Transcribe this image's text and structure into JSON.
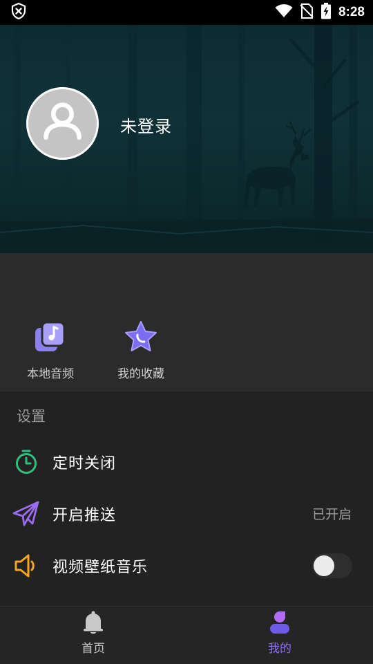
{
  "status_bar": {
    "time": "8:28",
    "icons": [
      "shield-x-icon",
      "wifi-icon",
      "no-sim-icon",
      "battery-charging-icon"
    ]
  },
  "profile": {
    "avatar_icon": "default-avatar-icon",
    "login_text": "未登录"
  },
  "quick_actions": [
    {
      "label": "本地音频",
      "icon": "local-audio-icon"
    },
    {
      "label": "我的收藏",
      "icon": "favorites-star-icon"
    }
  ],
  "settings": {
    "title": "设置",
    "items": [
      {
        "label": "定时关闭",
        "icon": "timer-icon",
        "value": ""
      },
      {
        "label": "开启推送",
        "icon": "paper-plane-icon",
        "value": "已开启"
      },
      {
        "label": "视频壁纸音乐",
        "icon": "speaker-icon",
        "toggle_on": false
      }
    ]
  },
  "bottom_nav": [
    {
      "label": "首页",
      "icon": "bell-icon",
      "active": false
    },
    {
      "label": "我的",
      "icon": "profile-icon",
      "active": true
    }
  ],
  "colors": {
    "accent": "#7b5cf0",
    "timer_green": "#2fc07e",
    "plane_purple": "#9b6cf0",
    "speaker_orange": "#f5a623",
    "active_nav": "#8f6ef5",
    "inactive_nav": "#c9c9c9"
  }
}
